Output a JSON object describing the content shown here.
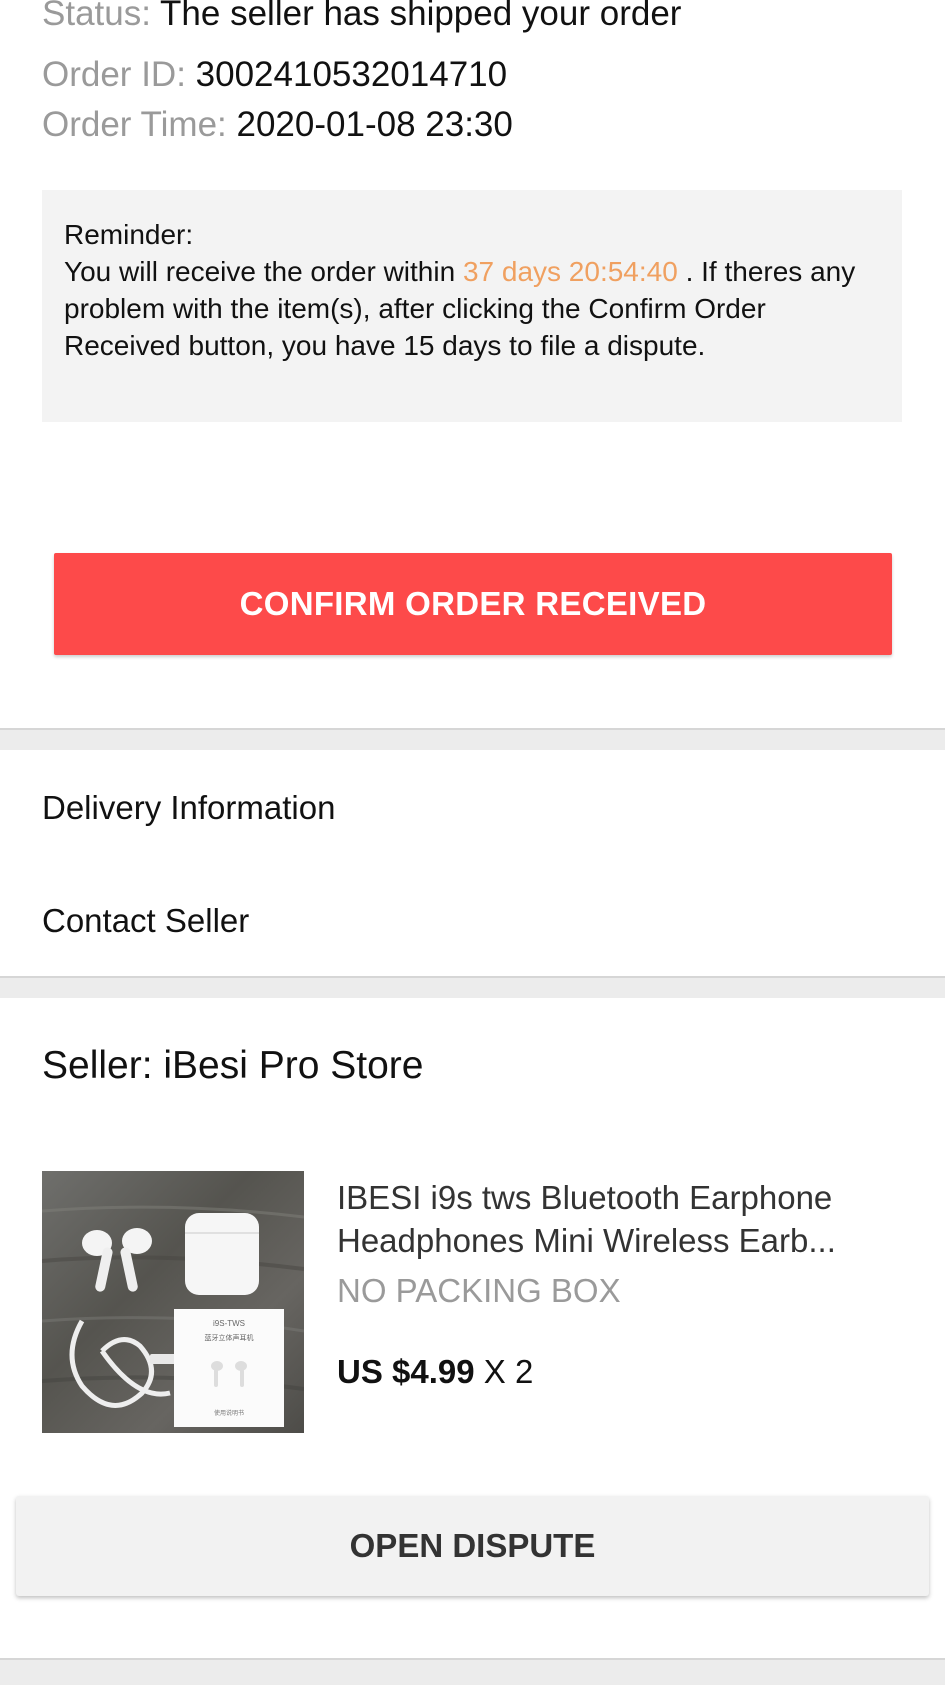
{
  "order": {
    "status_label": "Status:",
    "status_value": "The seller has shipped your order",
    "id_label": "Order ID:",
    "id_value": "3002410532014710",
    "time_label": "Order Time:",
    "time_value": "2020-01-08 23:30"
  },
  "reminder": {
    "heading": "Reminder:",
    "text_before": "You will receive the order within ",
    "countdown": "37 days 20:54:40",
    "text_after": " . If theres any problem with the item(s), after clicking the Confirm Order Received button, you have 15 days to file a dispute.",
    "countdown_color": "#f0a060"
  },
  "actions": {
    "confirm_label": "CONFIRM ORDER RECEIVED",
    "confirm_color": "#fd4a4a",
    "dispute_label": "OPEN DISPUTE"
  },
  "links": {
    "delivery": "Delivery Information",
    "contact": "Contact Seller"
  },
  "seller": {
    "name_line": "Seller: iBesi Pro Store"
  },
  "product": {
    "title_line1": "IBESI i9s tws Bluetooth Earphone",
    "title_line2": "Headphones Mini Wireless Earb...",
    "variant": "NO PACKING BOX",
    "price": "US $4.99",
    "quantity": "X 2",
    "image_icon": "earbuds-product-photo",
    "box_label_line1": "i9S-TWS",
    "box_label_line2": "蓝牙立体声耳机",
    "box_label_line3": "使用说明书"
  }
}
